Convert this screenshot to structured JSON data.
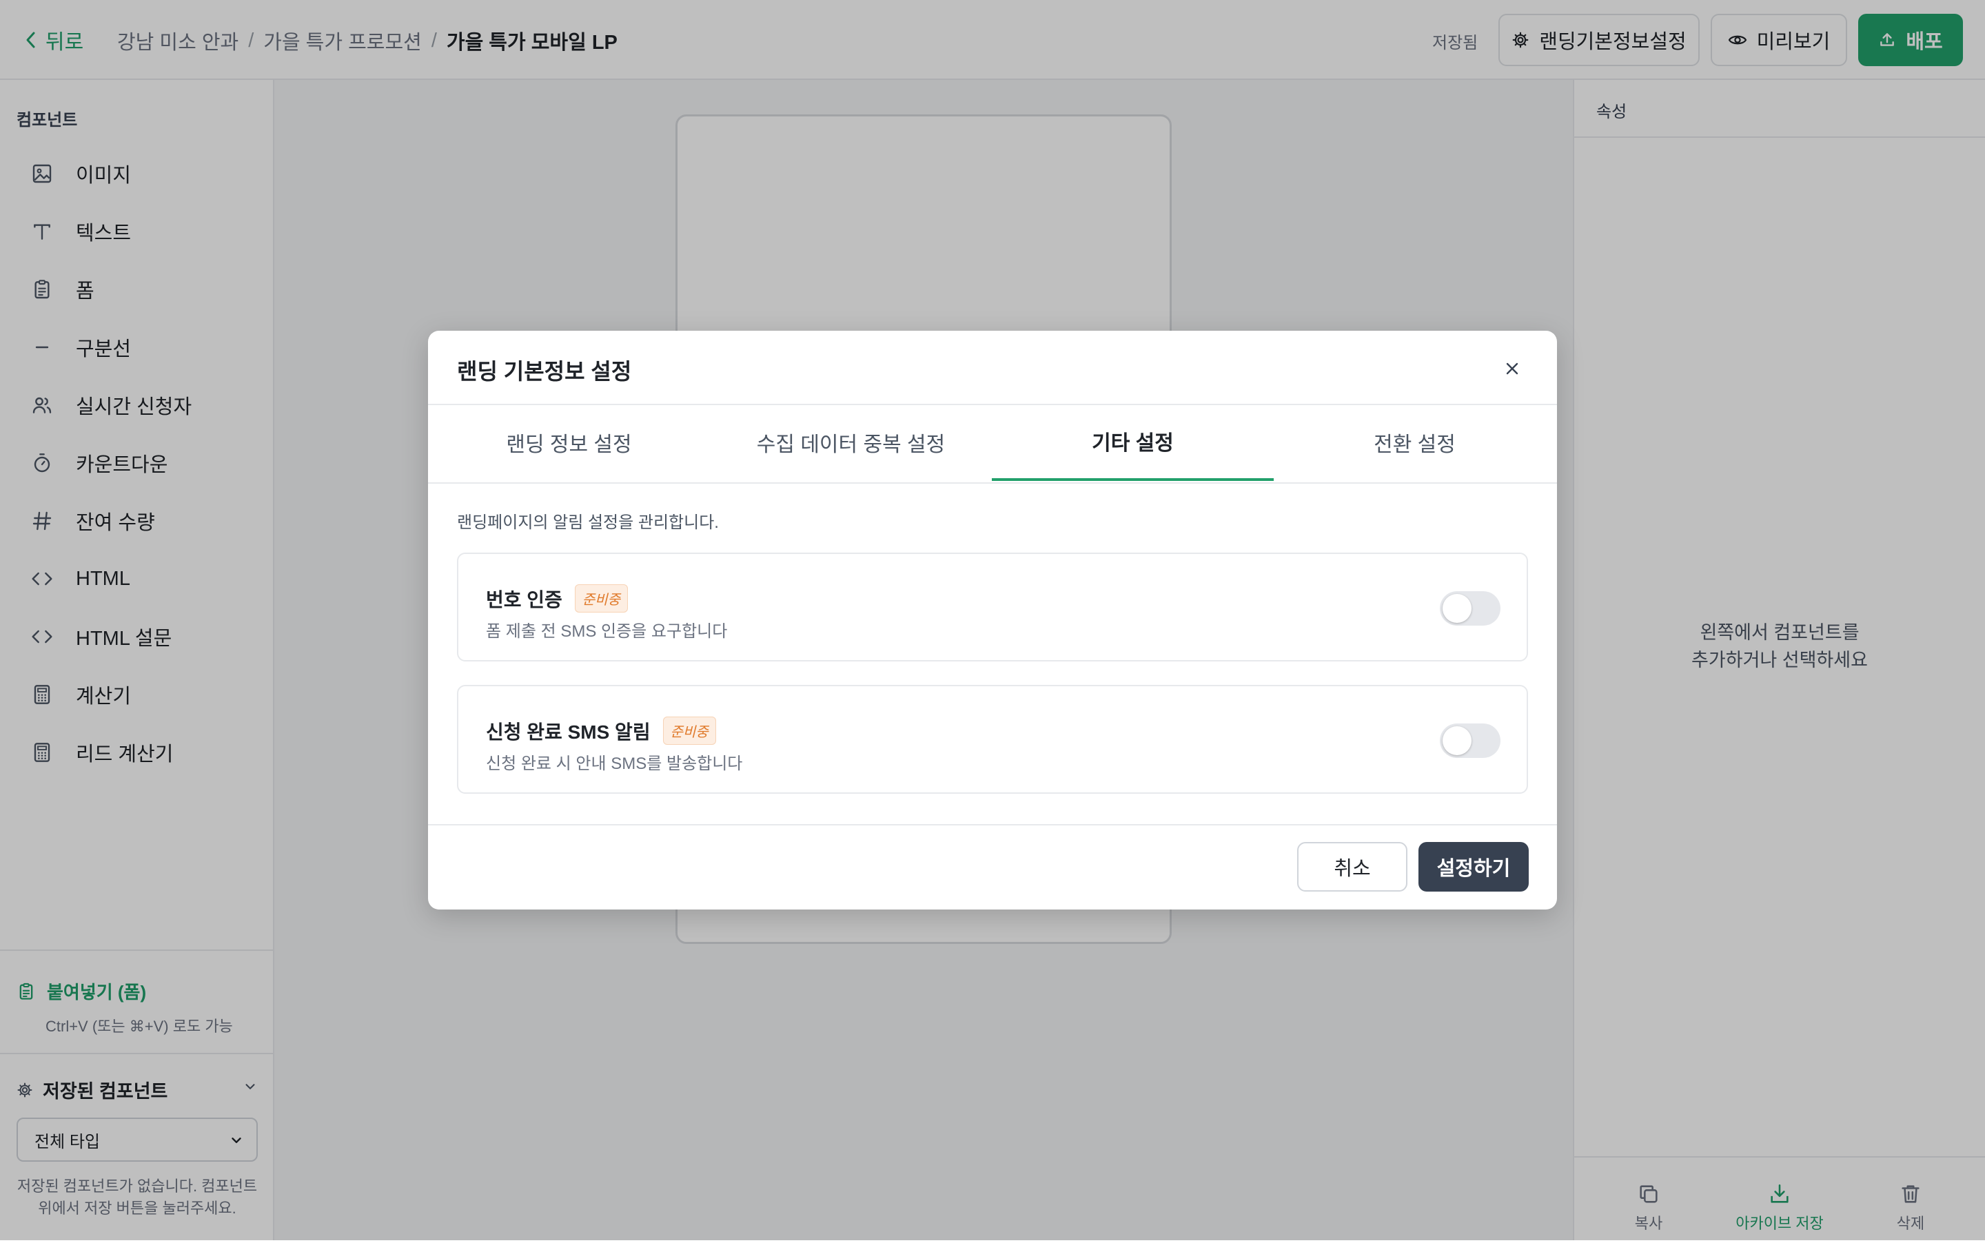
{
  "header": {
    "back_label": "뒤로",
    "breadcrumbs": [
      "강남 미소 안과",
      "가을 특가 프로모션",
      "가을 특가 모바일 LP"
    ],
    "breadcrumb_sep": "/",
    "save_status": "저장됨",
    "settings_button": "랜딩기본정보설정",
    "preview_button": "미리보기",
    "deploy_button": "배포"
  },
  "sidebar": {
    "title": "컴포넌트",
    "items": [
      {
        "label": "이미지",
        "icon": "image-icon"
      },
      {
        "label": "텍스트",
        "icon": "text-icon"
      },
      {
        "label": "폼",
        "icon": "clipboard-icon"
      },
      {
        "label": "구분선",
        "icon": "divider-icon"
      },
      {
        "label": "실시간 신청자",
        "icon": "users-icon"
      },
      {
        "label": "카운트다운",
        "icon": "timer-icon"
      },
      {
        "label": "잔여 수량",
        "icon": "hash-icon"
      },
      {
        "label": "HTML",
        "icon": "code-icon"
      },
      {
        "label": "HTML 설문",
        "icon": "code-icon"
      },
      {
        "label": "계산기",
        "icon": "calculator-icon"
      },
      {
        "label": "리드 계산기",
        "icon": "calculator-icon"
      }
    ],
    "paste_label": "붙여넣기 (폼)",
    "paste_hint": "Ctrl+V (또는 ⌘+V) 로도 가능",
    "saved_components_title": "저장된 컴포넌트",
    "filter_selected": "전체 타입",
    "saved_empty": "저장된 컴포넌트가 없습니다. 컴포넌트 위에서 저장 버튼을 눌러주세요."
  },
  "right_panel": {
    "title": "속성",
    "empty_line1": "왼쪽에서 컴포넌트를",
    "empty_line2": "추가하거나 선택하세요",
    "actions": [
      {
        "label": "복사",
        "icon": "copy-icon"
      },
      {
        "label": "아카이브 저장",
        "icon": "archive-download-icon"
      },
      {
        "label": "삭제",
        "icon": "trash-icon"
      }
    ]
  },
  "modal": {
    "title": "랜딩 기본정보 설정",
    "tabs": [
      {
        "label": "랜딩 정보 설정",
        "active": false
      },
      {
        "label": "수집 데이터 중복 설정",
        "active": false
      },
      {
        "label": "기타 설정",
        "active": true
      },
      {
        "label": "전환 설정",
        "active": false
      }
    ],
    "description": "랜딩페이지의 알림 설정을 관리합니다.",
    "settings": [
      {
        "title": "번호 인증",
        "badge": "준비중",
        "subtitle": "폼 제출 전 SMS 인증을 요구합니다",
        "enabled": false
      },
      {
        "title": "신청 완료 SMS 알림",
        "badge": "준비중",
        "subtitle": "신청 완료 시 안내 SMS를 발송합니다",
        "enabled": false
      }
    ],
    "cancel_button": "취소",
    "confirm_button": "설정하기"
  },
  "colors": {
    "accent": "#22a06b",
    "dark_button": "#374151",
    "badge_text": "#e07a2b",
    "badge_bg": "#fdeee2"
  }
}
